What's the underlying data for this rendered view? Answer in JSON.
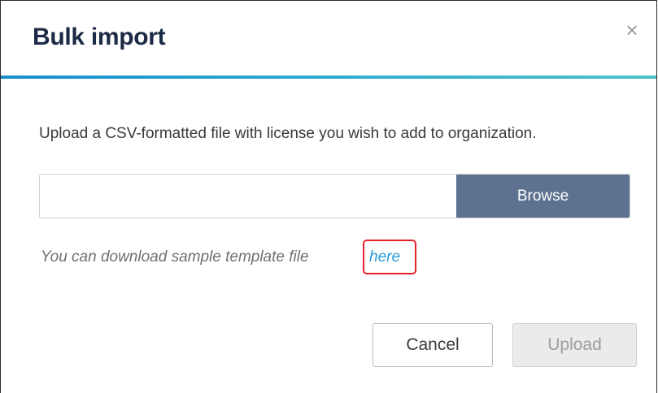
{
  "dialog": {
    "title": "Bulk import",
    "close_icon": "close-icon",
    "close_glyph": "×",
    "accent_colors": [
      "#1a8fc9",
      "#4cc3c9"
    ]
  },
  "upload": {
    "description": "Upload a CSV-formatted file with license you wish to add to organization.",
    "file_input_value": "",
    "browse_label": "Browse"
  },
  "template": {
    "hint_text": "You can download sample template file",
    "link_label": "here",
    "highlight_color": "#e8202a"
  },
  "footer": {
    "cancel_label": "Cancel",
    "upload_label": "Upload",
    "upload_enabled": false
  }
}
